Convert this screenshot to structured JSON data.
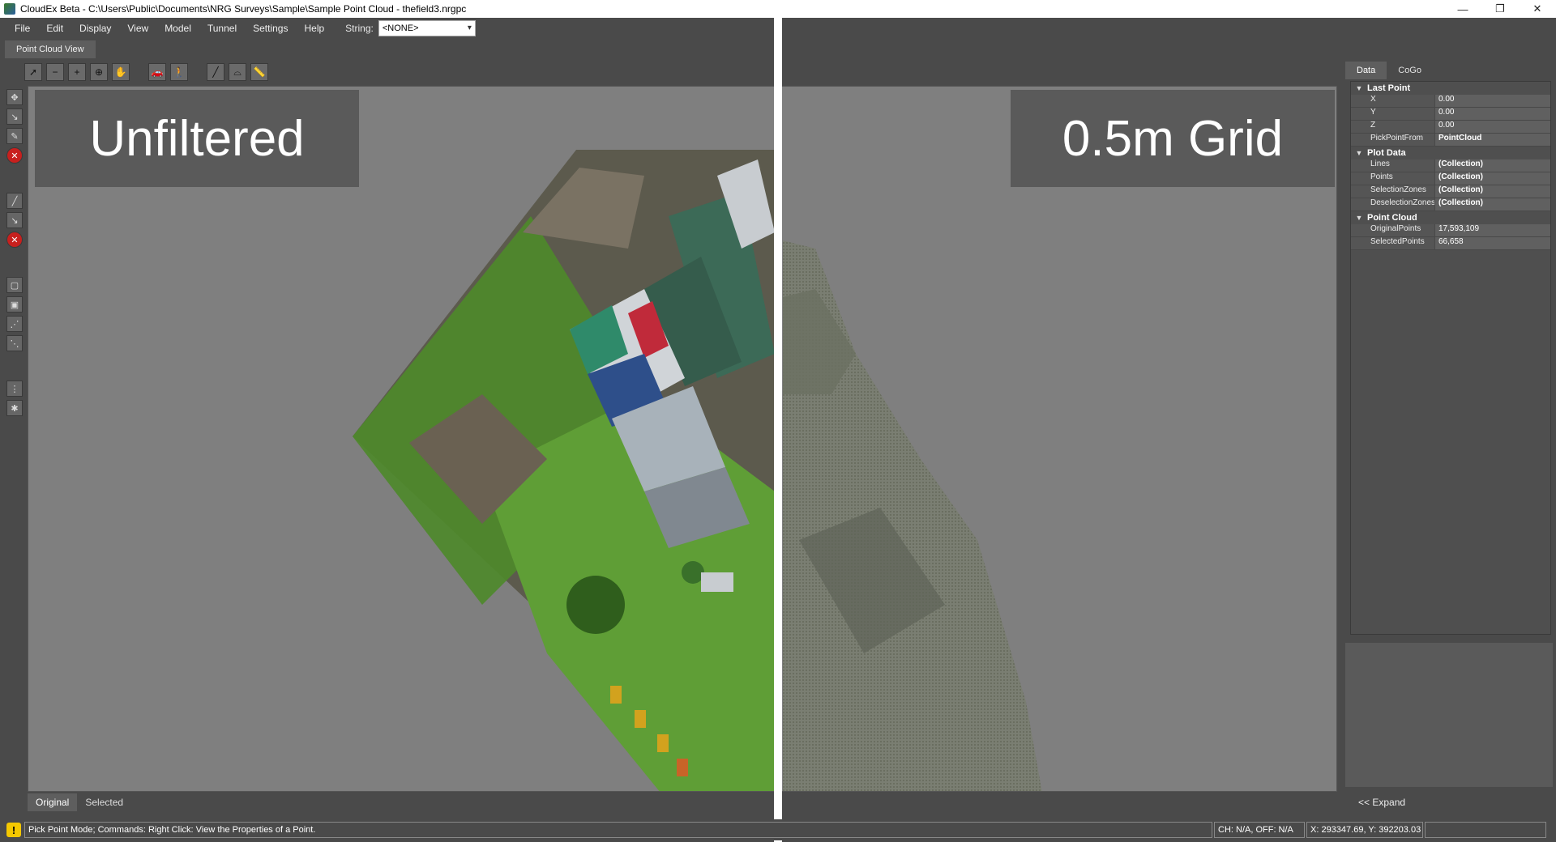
{
  "window": {
    "title": "CloudEx Beta - C:\\Users\\Public\\Documents\\NRG Surveys\\Sample\\Sample Point Cloud - thefield3.nrgpc",
    "minimize": "—",
    "restore": "❐",
    "close": "✕"
  },
  "menu": {
    "items": [
      "File",
      "Edit",
      "Display",
      "View",
      "Model",
      "Tunnel",
      "Settings",
      "Help"
    ],
    "string_label": "String:",
    "string_value": "<NONE>"
  },
  "tab": {
    "label": "Point Cloud View"
  },
  "viewport": {
    "left_label": "Unfiltered",
    "right_label": "0.5m Grid"
  },
  "view_tabs": [
    "Original",
    "Selected"
  ],
  "right_panel": {
    "tabs": [
      "Data",
      "CoGo"
    ],
    "categories": [
      {
        "name": "Last Point",
        "rows": [
          {
            "key": "X",
            "value": "0.00"
          },
          {
            "key": "Y",
            "value": "0.00"
          },
          {
            "key": "Z",
            "value": "0.00"
          },
          {
            "key": "PickPointFrom",
            "value": "PointCloud"
          }
        ]
      },
      {
        "name": "Plot Data",
        "rows": [
          {
            "key": "Lines",
            "value": "(Collection)"
          },
          {
            "key": "Points",
            "value": "(Collection)"
          },
          {
            "key": "SelectionZones",
            "value": "(Collection)"
          },
          {
            "key": "DeselectionZones",
            "value": "(Collection)"
          }
        ]
      },
      {
        "name": "Point Cloud",
        "rows": [
          {
            "key": "OriginalPoints",
            "value": "17,593,109"
          },
          {
            "key": "SelectedPoints",
            "value": "66,658"
          }
        ]
      }
    ],
    "expand_label": "<< Expand"
  },
  "status": {
    "message": "Pick Point Mode; Commands: Right Click: View the Properties of a Point.",
    "ch_off": "CH: N/A, OFF: N/A",
    "coords": "X: 293347.69, Y: 392203.03",
    "extra": ""
  },
  "colors": {
    "background": "#4a4a4a",
    "viewport": "#7f7f7f",
    "grass": "#4f8f2a",
    "warning": "#f5c800"
  }
}
